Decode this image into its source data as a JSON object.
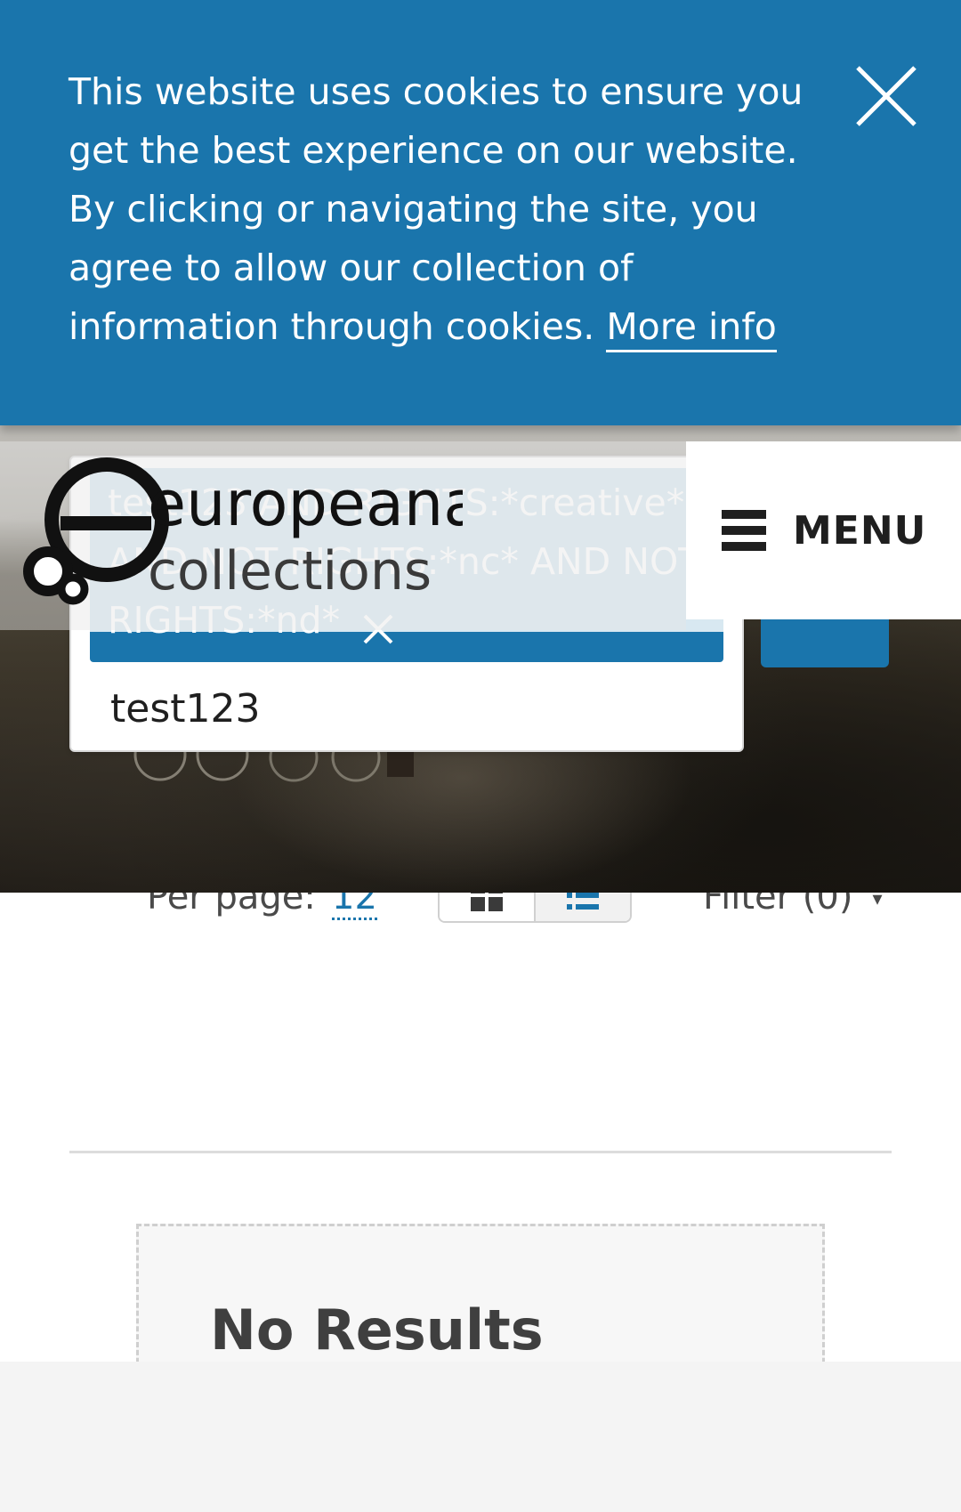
{
  "cookie_banner": {
    "message": "This website uses cookies to ensure you get the best experience on our website. By clicking or navigating the site, you agree to allow our collection of information through cookies.",
    "link_label": "More info",
    "close_icon": "close-icon"
  },
  "header": {
    "logo_primary": "europeana",
    "logo_secondary": "collections",
    "menu_label": "MENU",
    "menu_icon": "hamburger-icon"
  },
  "search": {
    "query_pill": "test123 AND RIGHTS:*creative* AND NOT RIGHTS:*nc* AND NOT RIGHTS:*nd*",
    "input_value": "test123",
    "remove_icon": "close-icon",
    "submit_icon": "search-icon"
  },
  "toolbar": {
    "per_page_label": "Per page:",
    "per_page_value": "12",
    "grid_icon": "grid-view-icon",
    "list_icon": "list-view-icon",
    "filter_label": "Filter (0)",
    "filter_caret": "▾"
  },
  "results": {
    "no_results_title": "No Results"
  },
  "colors": {
    "accent": "#1a75ac",
    "pill_bg": "#d8e8f1",
    "bottom_bar": "#f4f4f4"
  }
}
